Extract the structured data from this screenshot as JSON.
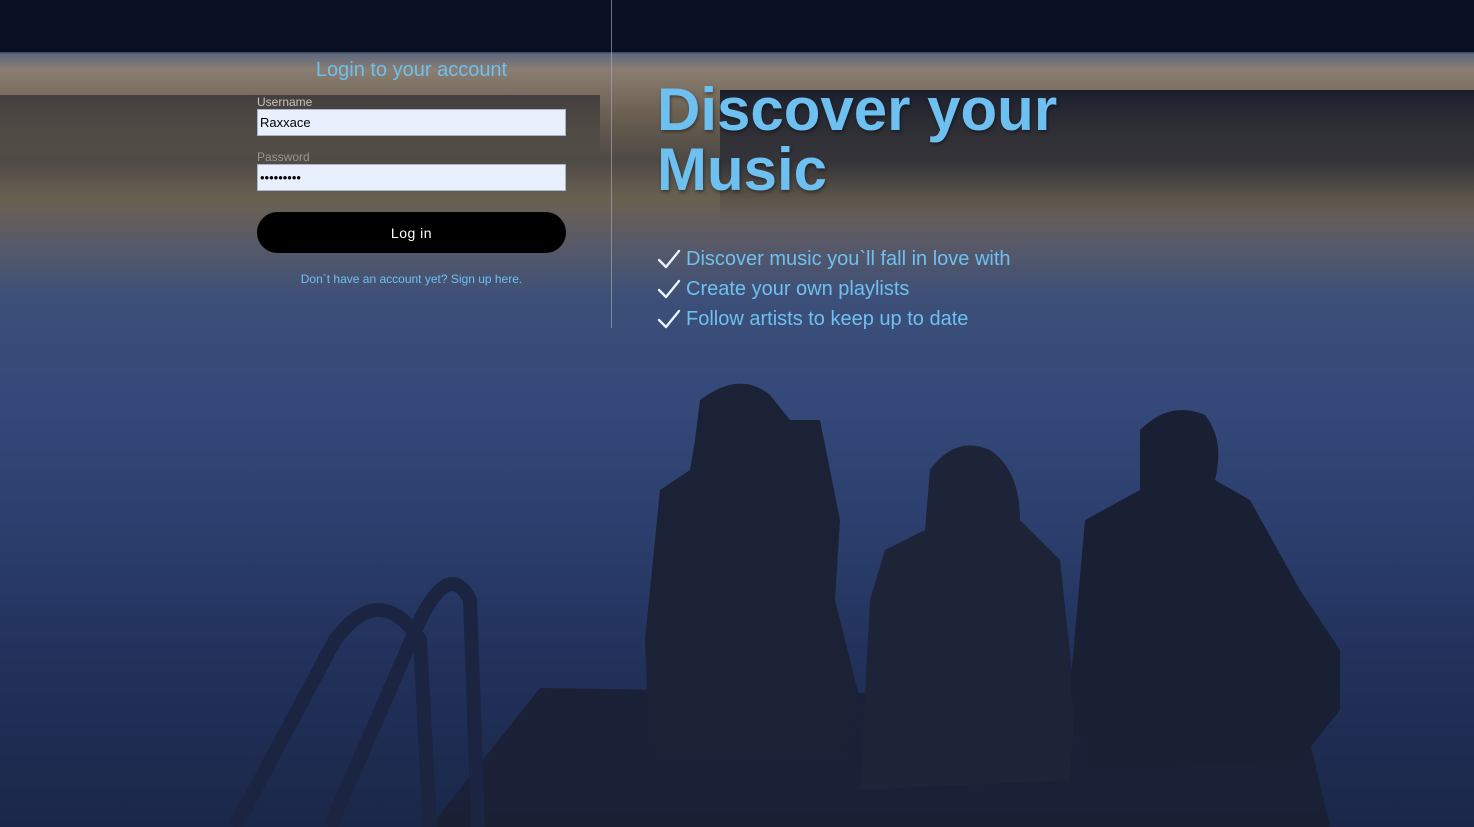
{
  "login": {
    "title": "Login to your account",
    "username_label": "Username",
    "username_value": "Raxxace",
    "password_label": "Password",
    "password_value": "•••••••••",
    "submit_label": "Log in",
    "signup_text": "Don`t have an account yet? Sign up here."
  },
  "hero": {
    "title": "Discover your Music",
    "features": [
      "Discover music you`ll fall in love with",
      "Create your own playlists",
      "Follow artists to keep up to date"
    ]
  },
  "colors": {
    "accent": "#6ec0f0",
    "button_bg": "#000000",
    "input_bg": "#e8f0fe"
  },
  "icons": {
    "feature_bullet": "checkmark-icon"
  }
}
